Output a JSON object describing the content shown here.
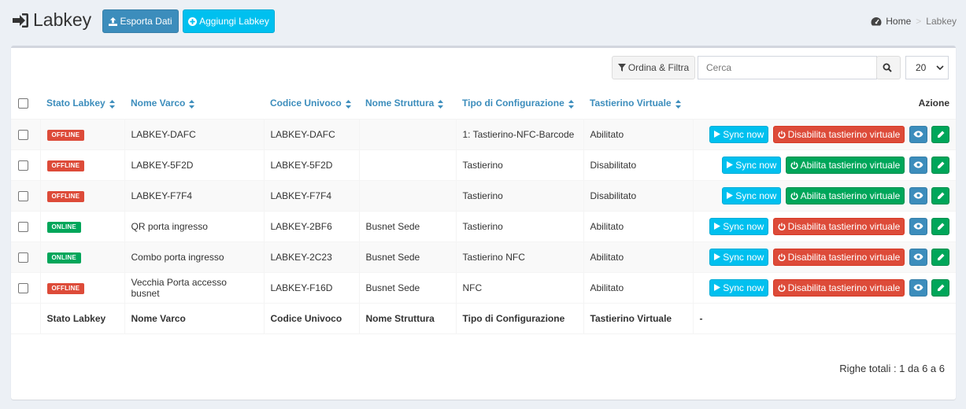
{
  "header": {
    "title": "Labkey",
    "export_label": "Esporta Dati",
    "add_label": "Aggiungi Labkey"
  },
  "breadcrumb": {
    "home": "Home",
    "separator": ">",
    "current": "Labkey"
  },
  "toolbar": {
    "filter_label": "Ordina & Filtra",
    "search_placeholder": "Cerca",
    "page_size": "20"
  },
  "table": {
    "columns": [
      "Stato Labkey",
      "Nome Varco",
      "Codice Univoco",
      "Nome Struttura",
      "Tipo di Configurazione",
      "Tastierino Virtuale",
      "Azione"
    ],
    "rows": [
      {
        "stato": "OFFLINE",
        "nome": "LABKEY-DAFC",
        "codice": "LABKEY-DAFC",
        "struttura": "",
        "tipo": "1: Tastierino-NFC-Barcode",
        "tastierino": "Abilitato",
        "toggle": "Disabilita tastierino virtuale"
      },
      {
        "stato": "OFFLINE",
        "nome": "LABKEY-5F2D",
        "codice": "LABKEY-5F2D",
        "struttura": "",
        "tipo": "Tastierino",
        "tastierino": "Disabilitato",
        "toggle": "Abilita tastierino virtuale"
      },
      {
        "stato": "OFFLINE",
        "nome": "LABKEY-F7F4",
        "codice": "LABKEY-F7F4",
        "struttura": "",
        "tipo": "Tastierino",
        "tastierino": "Disabilitato",
        "toggle": "Abilita tastierino virtuale"
      },
      {
        "stato": "ONLINE",
        "nome": "QR porta ingresso",
        "codice": "LABKEY-2BF6",
        "struttura": "Busnet Sede",
        "tipo": "Tastierino",
        "tastierino": "Abilitato",
        "toggle": "Disabilita tastierino virtuale"
      },
      {
        "stato": "ONLINE",
        "nome": "Combo porta ingresso",
        "codice": "LABKEY-2C23",
        "struttura": "Busnet Sede",
        "tipo": "Tastierino NFC",
        "tastierino": "Abilitato",
        "toggle": "Disabilita tastierino virtuale"
      },
      {
        "stato": "OFFLINE",
        "nome": "Vecchia Porta accesso busnet",
        "codice": "LABKEY-F16D",
        "struttura": "Busnet Sede",
        "tipo": "NFC",
        "tastierino": "Abilitato",
        "toggle": "Disabilita tastierino virtuale"
      }
    ],
    "sync_label": "Sync now",
    "footer": [
      "Stato Labkey",
      "Nome Varco",
      "Codice Univoco",
      "Nome Struttura",
      "Tipo di Configurazione",
      "Tastierino Virtuale",
      "-"
    ]
  },
  "totals": "Righe totali : 1 da 6 a 6",
  "colors": {
    "primary": "#3c8dbc",
    "info": "#00c0ef",
    "danger": "#dd4b39",
    "success": "#00a65a"
  },
  "icons": {
    "title": "sign-in-icon",
    "export": "upload-icon",
    "add": "plus-circle-icon",
    "home": "dashboard-icon",
    "filter": "filter-icon",
    "search": "search-icon",
    "sort": "sort-icon",
    "sync": "play-icon",
    "toggle": "power-icon",
    "view": "eye-icon",
    "edit": "pencil-icon"
  }
}
